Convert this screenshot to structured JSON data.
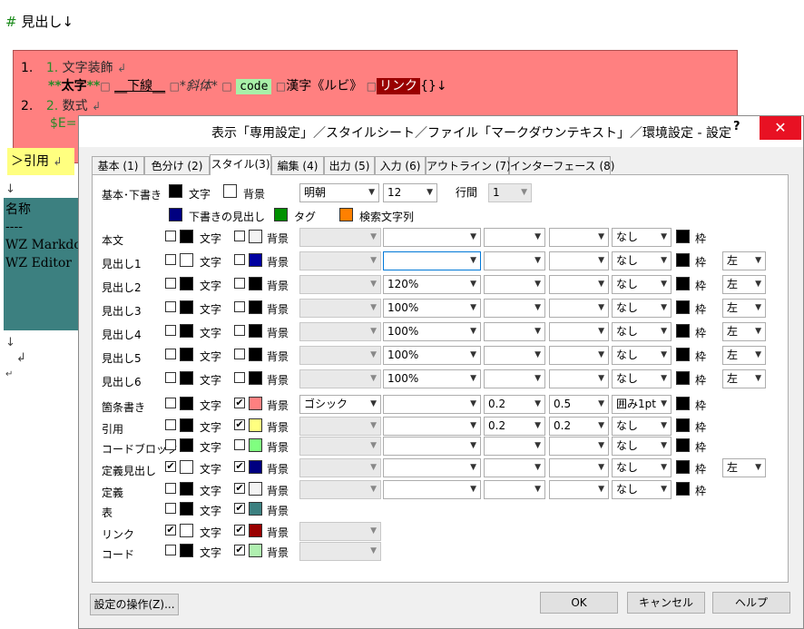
{
  "editor": {
    "heading": {
      "hash": "#",
      "text": " 見出し↓"
    },
    "list": {
      "line1": {
        "num": "1.",
        "marker": "1.",
        "text": "文字装飾",
        "ret": "↲"
      },
      "line2": {
        "bold_open": "**",
        "bold_text": "太字",
        "bold_close": "**",
        "sep": "□",
        "underline": "__下線__",
        "italic": "*斜体*",
        "code": "code",
        "ruby": "漢字《ルビ》",
        "link": "リンク",
        "tail": "{}↓"
      },
      "line3": {
        "num": "2.",
        "marker": "2.",
        "text": "数式",
        "ret": "↲"
      },
      "line4": {
        "text": "$E="
      }
    },
    "quote": {
      "text": "＞引用",
      "ret": "↲"
    },
    "table": {
      "header": "名称",
      "rule": "----",
      "row1": "WZ Markdo",
      "row2": "WZ Editor"
    },
    "arrows": {
      "a1": "↓",
      "a2": "↓",
      "a3": "↲",
      "a4": "↵"
    }
  },
  "dialog": {
    "title": "表示「専用設定」／スタイルシート／ファイル「マークダウンテキスト」／環境設定 - 設定",
    "help": "?",
    "close": "✕",
    "tabs": [
      "基本 (1)",
      "色分け (2)",
      "スタイル(3)",
      "編集 (4)",
      "出力 (5)",
      "入力 (6)",
      "アウトライン (7)",
      "インターフェース (8)"
    ],
    "base": {
      "label": "基本･下書き",
      "text_label": "文字",
      "bg_label": "背景",
      "font": "明朝",
      "size": "12",
      "spacing_label": "行間",
      "spacing": "1",
      "draft_heading": "下書きの見出し",
      "tag": "タグ",
      "search": "検索文字列"
    },
    "common": {
      "text_label": "文字",
      "bg_label": "背景",
      "frame_label": "枠"
    },
    "rows": [
      {
        "label": "本文",
        "size": "",
        "border": "なし",
        "align": ""
      },
      {
        "label": "見出し1",
        "size": "",
        "border": "なし",
        "align": "左"
      },
      {
        "label": "見出し2",
        "size": "120%",
        "border": "なし",
        "align": "左"
      },
      {
        "label": "見出し3",
        "size": "100%",
        "border": "なし",
        "align": "左"
      },
      {
        "label": "見出し4",
        "size": "100%",
        "border": "なし",
        "align": "左"
      },
      {
        "label": "見出し5",
        "size": "100%",
        "border": "なし",
        "align": "左"
      },
      {
        "label": "見出し6",
        "size": "100%",
        "border": "なし",
        "align": "左"
      },
      {
        "label": "箇条書き",
        "font": "ゴシック",
        "v1": "0.2",
        "v2": "0.5",
        "border": "囲み1pt"
      },
      {
        "label": "引用",
        "v1": "0.2",
        "v2": "0.2",
        "border": "なし"
      },
      {
        "label": "コードブロック",
        "border": "なし"
      },
      {
        "label": "定義見出し",
        "border": "なし",
        "align": "左"
      },
      {
        "label": "定義",
        "border": "なし"
      },
      {
        "label": "表"
      },
      {
        "label": "リンク"
      },
      {
        "label": "コード"
      }
    ],
    "buttons": {
      "ops": "設定の操作(Z)...",
      "ok": "OK",
      "cancel": "キャンセル",
      "help": "ヘルプ"
    }
  },
  "colors": {
    "accent": "#0078d7",
    "close": "#e81123",
    "heading_bg": "#ff8080",
    "quote_bg": "#ffff80",
    "table_bg": "#3c8080"
  }
}
